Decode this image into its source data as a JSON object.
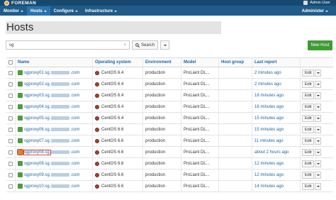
{
  "app": {
    "brand": "FOREMAN",
    "user": "Admin User"
  },
  "nav": {
    "items": [
      {
        "label": "Monitor",
        "active": false
      },
      {
        "label": "Hosts",
        "active": true
      },
      {
        "label": "Configure",
        "active": false
      },
      {
        "label": "Infrastructure",
        "active": false
      }
    ],
    "right": "Administer"
  },
  "page": {
    "title": "Hosts"
  },
  "search": {
    "value": "sg",
    "clear": "×",
    "button_label": "Search",
    "icon": "magnifier-icon"
  },
  "actions": {
    "new_host": "New Host"
  },
  "table": {
    "headers": {
      "name": "Name",
      "os": "Operating system",
      "environment": "Environment",
      "model": "Model",
      "hostgroup": "Host group",
      "last_report": "Last report"
    },
    "rows": [
      {
        "name_prefix": "sgproxy01.sg.",
        "name_suffix": ".com",
        "os": "CentOS 6.4",
        "environment": "production",
        "model": "ProLiant DL...",
        "hostgroup": "",
        "last_report": "2 minutes ago",
        "status": "ok",
        "edit": "Edit"
      },
      {
        "name_prefix": "sgproxy02.sg.",
        "name_suffix": ".com",
        "os": "CentOS 6.4",
        "environment": "production",
        "model": "ProLiant DL...",
        "hostgroup": "",
        "last_report": "2 minutes ago",
        "status": "ok",
        "edit": "Edit"
      },
      {
        "name_prefix": "sgproxy03.sg.",
        "name_suffix": ".com",
        "os": "CentOS 6.4",
        "environment": "production",
        "model": "ProLiant DL...",
        "hostgroup": "",
        "last_report": "18 minutes ago",
        "status": "ok",
        "edit": "Edit"
      },
      {
        "name_prefix": "sgproxy04.sg.",
        "name_suffix": ".com",
        "os": "CentOS 6.4",
        "environment": "production",
        "model": "ProLiant DL...",
        "hostgroup": "",
        "last_report": "16 minutes ago",
        "status": "ok",
        "edit": "Edit"
      },
      {
        "name_prefix": "sgproxy05.sg.",
        "name_suffix": ".com",
        "os": "CentOS 6.4",
        "environment": "production",
        "model": "ProLiant DL...",
        "hostgroup": "",
        "last_report": "15 minutes ago",
        "status": "ok",
        "edit": "Edit"
      },
      {
        "name_prefix": "sgproxy06.sg.",
        "name_suffix": ".com",
        "os": "CentOS 6.6",
        "environment": "production",
        "model": "ProLiant DL...",
        "hostgroup": "",
        "last_report": "15 minutes ago",
        "status": "ok",
        "edit": "Edit"
      },
      {
        "name_prefix": "sgproxy07.sg.",
        "name_suffix": ".com",
        "os": "CentOS 6.6",
        "environment": "production",
        "model": "ProLiant DL...",
        "hostgroup": "",
        "last_report": "11 minutes ago",
        "status": "ok",
        "edit": "Edit"
      },
      {
        "name_prefix": "sgproxy08.sg.",
        "name_suffix": ".com",
        "os": "CentOS 6.6",
        "environment": "production",
        "model": "ProLiant DL...",
        "hostgroup": "",
        "last_report": "about 2 hours ago",
        "status": "warn",
        "edit": "Edit"
      },
      {
        "name_prefix": "sgproxy08.sg.",
        "name_suffix": ".com",
        "os": "CentOS 6.6",
        "environment": "production",
        "model": "ProLiant DL...",
        "hostgroup": "",
        "last_report": "12 minutes ago",
        "status": "ok",
        "edit": "Edit"
      },
      {
        "name_prefix": "sgproxy09.sg.",
        "name_suffix": ".com",
        "os": "CentOS 6.6",
        "environment": "production",
        "model": "ProLiant DL...",
        "hostgroup": "",
        "last_report": "12 minutes ago",
        "status": "ok",
        "edit": "Edit"
      },
      {
        "name_prefix": "sgproxy10.sg.",
        "name_suffix": ".com",
        "os": "CentOS 6.6",
        "environment": "production",
        "model": "ProLiant DL...",
        "hostgroup": "",
        "last_report": "14 minutes ago",
        "status": "ok",
        "edit": "Edit"
      }
    ]
  },
  "colors": {
    "topbar": "#1f5c8a",
    "link": "#1a66a8",
    "new_host": "#3f9c35",
    "status_ok": "#4a9e3a",
    "status_warn": "#d9822b"
  }
}
